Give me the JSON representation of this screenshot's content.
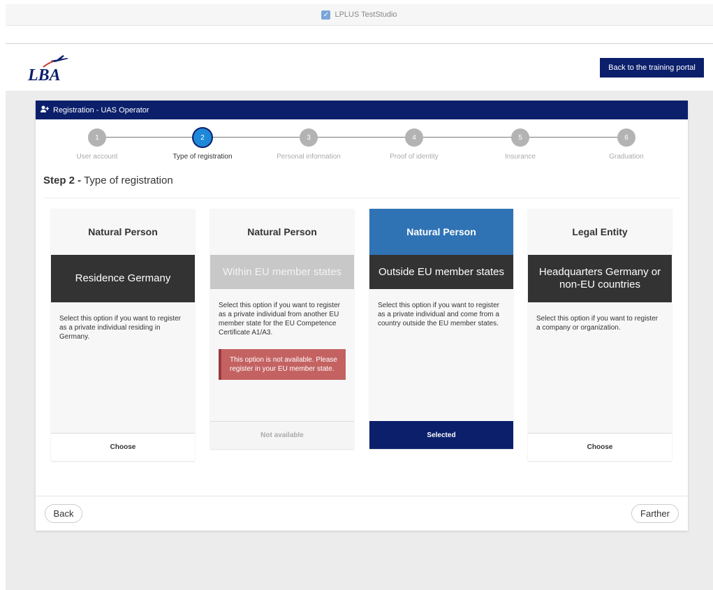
{
  "titlebar": {
    "title": "LPLUS TestStudio",
    "icon": "checkbox-icon"
  },
  "header": {
    "logo_text": "LBA",
    "portal_button": "Back to the training portal"
  },
  "panel": {
    "title": "Registration - UAS Operator",
    "title_icon": "add-user-icon"
  },
  "stepper": {
    "steps": [
      {
        "number": "1",
        "label": "User account",
        "active": false
      },
      {
        "number": "2",
        "label": "Type of registration",
        "active": true
      },
      {
        "number": "3",
        "label": "Personal information",
        "active": false
      },
      {
        "number": "4",
        "label": "Proof of identity",
        "active": false
      },
      {
        "number": "5",
        "label": "Insurance",
        "active": false
      },
      {
        "number": "6",
        "label": "Graduation",
        "active": false
      }
    ]
  },
  "step_title": {
    "prefix": "Step 2 -",
    "text": "Type of registration"
  },
  "cards": [
    {
      "heading": "Natural Person",
      "band": "Residence Germany",
      "description": "Select this option if you want to register as a private individual residing in Germany.",
      "footer": "Choose",
      "state": "default"
    },
    {
      "heading": "Natural Person",
      "band": "Within EU member states",
      "description": "Select this option if you want to register as a private individual from another EU member state for the EU Competence Certificate A1/A3.",
      "alert": "This option is not available. Please register in your EU member state.",
      "footer": "Not available",
      "state": "disabled"
    },
    {
      "heading": "Natural Person",
      "band": "Outside EU member states",
      "description": "Select this option if you want to register as a private individual and come from a country outside the EU member states.",
      "footer": "Selected",
      "state": "selected"
    },
    {
      "heading": "Legal Entity",
      "band": "Headquarters Germany or non-EU countries",
      "description": "Select this option if you want to register a company or organization.",
      "footer": "Choose",
      "state": "default"
    }
  ],
  "nav": {
    "back": "Back",
    "next": "Farther"
  },
  "colors": {
    "brand_navy": "#0b1f6b",
    "active_step": "#1e88d8",
    "selected_card": "#2f73b5",
    "alert": "#c46262"
  }
}
